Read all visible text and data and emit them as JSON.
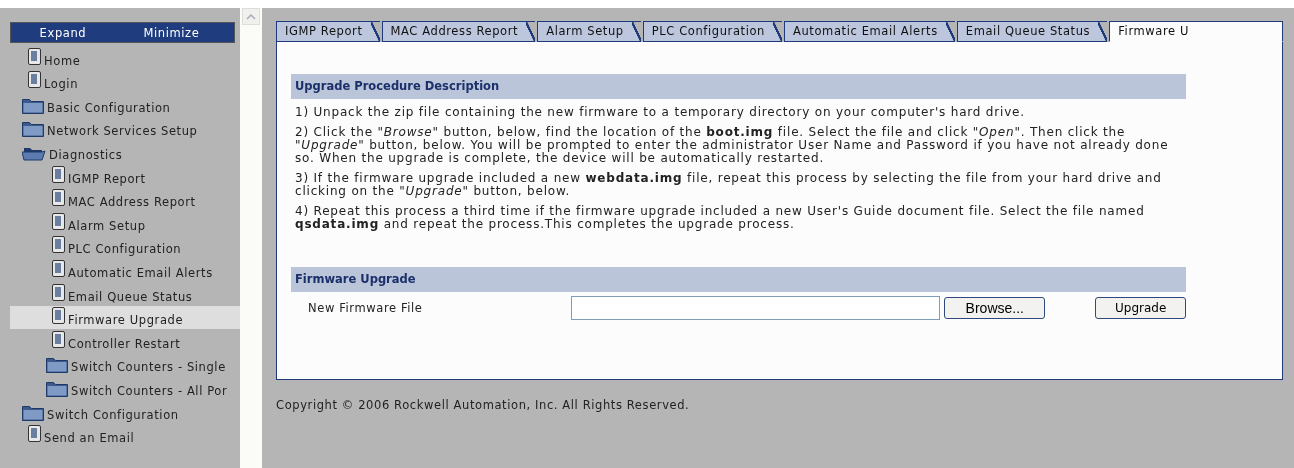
{
  "sidebar": {
    "header": {
      "expand": "Expand",
      "minimize": "Minimize"
    },
    "items": [
      {
        "label": "Home",
        "kind": "page",
        "selected": false
      },
      {
        "label": "Login",
        "kind": "page",
        "selected": false
      },
      {
        "label": "Basic Configuration",
        "kind": "folder",
        "expanded": false,
        "selected": false
      },
      {
        "label": "Network Services Setup",
        "kind": "folder",
        "expanded": false,
        "selected": false
      },
      {
        "label": "Diagnostics",
        "kind": "folder",
        "expanded": true,
        "selected": false,
        "children": [
          {
            "label": "IGMP Report",
            "kind": "page",
            "selected": false
          },
          {
            "label": "MAC Address Report",
            "kind": "page",
            "selected": false
          },
          {
            "label": "Alarm Setup",
            "kind": "page",
            "selected": false
          },
          {
            "label": "PLC Configuration",
            "kind": "page",
            "selected": false
          },
          {
            "label": "Automatic Email Alerts",
            "kind": "page",
            "selected": false
          },
          {
            "label": "Email Queue Status",
            "kind": "page",
            "selected": false
          },
          {
            "label": "Firmware Upgrade",
            "kind": "page",
            "selected": true
          },
          {
            "label": "Controller Restart",
            "kind": "page",
            "selected": false
          },
          {
            "label": "Switch Counters - Single",
            "kind": "folder",
            "expanded": false,
            "selected": false
          },
          {
            "label": "Switch Counters - All Por",
            "kind": "folder",
            "expanded": false,
            "selected": false
          }
        ]
      },
      {
        "label": "Switch Configuration",
        "kind": "folder",
        "expanded": false,
        "selected": false
      },
      {
        "label": "Send an Email",
        "kind": "page",
        "selected": false
      }
    ]
  },
  "tabs": [
    {
      "label": "IGMP Report",
      "selected": false
    },
    {
      "label": "MAC Address Report",
      "selected": false
    },
    {
      "label": "Alarm Setup",
      "selected": false
    },
    {
      "label": "PLC Configuration",
      "selected": false
    },
    {
      "label": "Automatic Email Alerts",
      "selected": false
    },
    {
      "label": "Email Queue Status",
      "selected": false
    },
    {
      "label": "Firmware U",
      "selected": true
    }
  ],
  "procedure": {
    "heading": "Upgrade Procedure Description",
    "steps": [
      "1) Unpack the zip file containing the new firmware to a temporary directory on your computer's hard drive.",
      "2) Click the \"*Browse*\" button, below, find the location of the **boot.img** file. Select the file and click \"*Open*\". Then click the \"*Upgrade*\" button, below. You will be prompted to enter the administrator User Name and Password if you have not already done so. When the upgrade is complete, the device will be automatically restarted.",
      "3) If the firmware upgrade included a new **webdata.img** file, repeat this process by selecting the file from your hard drive and clicking on the \"*Upgrade*\" button, below.",
      "4) Repeat this process a third time if the firmware upgrade included a new User's Guide document file. Select the file named **qsdata.img** and repeat the process.This completes the upgrade process."
    ]
  },
  "upgrade": {
    "heading": "Firmware Upgrade",
    "label": "New Firmware File",
    "browse": "Browse...",
    "button": "Upgrade"
  },
  "copyright": "Copyright © 2006 Rockwell Automation, Inc. All Rights Reserved."
}
